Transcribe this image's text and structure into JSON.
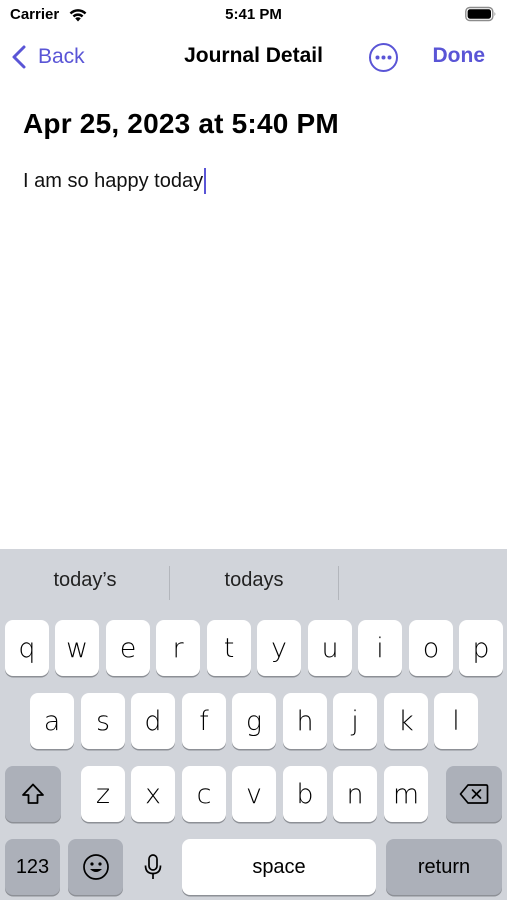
{
  "status_bar": {
    "carrier": "Carrier",
    "time": "5:41 PM",
    "icons": [
      "wifi-icon",
      "battery-icon"
    ]
  },
  "nav": {
    "back_label": "Back",
    "title": "Journal Detail",
    "more_icon": "ellipsis-circle-icon",
    "done_label": "Done",
    "accent_color": "#5a55d6"
  },
  "entry": {
    "date": "Apr 25, 2023 at 5:40 PM",
    "body": "I am so happy today"
  },
  "keyboard": {
    "suggestions": [
      "today’s",
      "todays",
      ""
    ],
    "row1": [
      "q",
      "w",
      "e",
      "r",
      "t",
      "y",
      "u",
      "i",
      "o",
      "p"
    ],
    "row2": [
      "a",
      "s",
      "d",
      "f",
      "g",
      "h",
      "j",
      "k",
      "l"
    ],
    "row3": [
      "z",
      "x",
      "c",
      "v",
      "b",
      "n",
      "m"
    ],
    "numbers_label": "123",
    "space_label": "space",
    "return_label": "return",
    "icons": [
      "shift-icon",
      "delete-icon",
      "emoji-icon",
      "microphone-icon"
    ]
  }
}
